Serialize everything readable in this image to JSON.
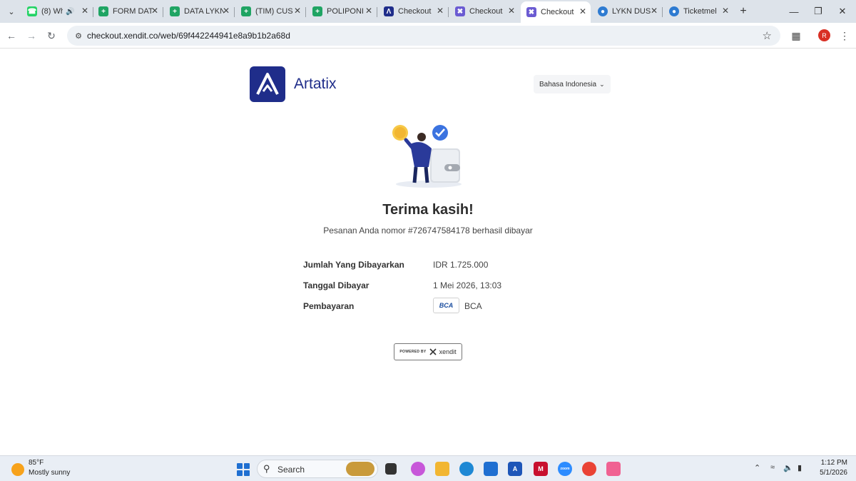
{
  "browser": {
    "tabs": [
      {
        "label": "(8) Wh",
        "icon": "whatsapp-icon",
        "color": "#25d366"
      },
      {
        "label": "FORM DAT",
        "icon": "sheets-icon",
        "color": "#1fa463"
      },
      {
        "label": "DATA LYKN",
        "icon": "sheets-icon",
        "color": "#1fa463"
      },
      {
        "label": "(TIM) CUS",
        "icon": "sheets-icon",
        "color": "#1fa463"
      },
      {
        "label": "POLIPONI",
        "icon": "sheets-icon",
        "color": "#1fa463"
      },
      {
        "label": "Checkout",
        "icon": "artatix-icon",
        "color": "#1f2d8a"
      },
      {
        "label": "Checkout",
        "icon": "xendit-icon",
        "color": "#6b5bd2"
      },
      {
        "label": "Checkout",
        "icon": "xendit-icon",
        "color": "#6b5bd2",
        "active": true
      },
      {
        "label": "LYKN DUS",
        "icon": "globe-icon",
        "color": "#2e7bd1"
      },
      {
        "label": "Ticketmel",
        "icon": "globe-icon",
        "color": "#2e7bd1"
      }
    ],
    "url": "checkout.xendit.co/web/69f442244941e8a9b1b2a68d"
  },
  "page": {
    "brand_name": "Artatix",
    "language": "Bahasa Indonesia",
    "thanks": "Terima kasih!",
    "order_message": "Pesanan Anda nomor #726747584178 berhasil dibayar",
    "details": {
      "amount_label": "Jumlah Yang Dibayarkan",
      "amount_value": "IDR 1.725.000",
      "date_label": "Tanggal Dibayar",
      "date_value": "1 Mei 2026, 13:03",
      "payment_label": "Pembayaran",
      "bank_logo": "BCA",
      "bank_name": "BCA"
    },
    "powered_by": "POWERED BY",
    "powered_brand": "xendit"
  },
  "taskbar": {
    "temperature": "85°F",
    "weather": "Mostly sunny",
    "search": "Search",
    "time": "1:12 PM",
    "date": "5/1/2026"
  }
}
